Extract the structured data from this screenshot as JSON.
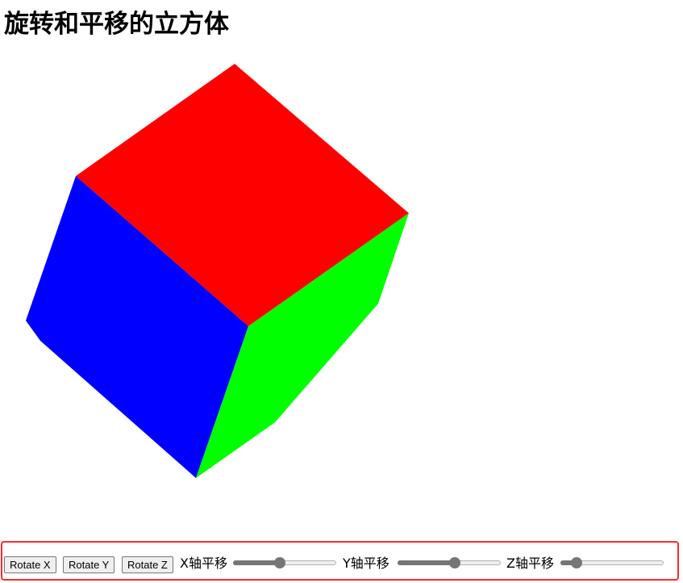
{
  "page": {
    "title": "旋转和平移的立方体"
  },
  "cube": {
    "faces": [
      {
        "name": "top",
        "color": "#ff0000"
      },
      {
        "name": "left",
        "color": "#0000ff"
      },
      {
        "name": "right",
        "color": "#00ff00"
      }
    ]
  },
  "controls": {
    "buttons": {
      "rotate_x": "Rotate X",
      "rotate_y": "Rotate Y",
      "rotate_z": "Rotate Z"
    },
    "sliders": [
      {
        "label": "X轴平移",
        "value_fraction": 0.45
      },
      {
        "label": "Y轴平移",
        "value_fraction": 0.56
      },
      {
        "label": "Z轴平移",
        "value_fraction": 0.11
      }
    ],
    "border_color": "#ff2a2a"
  }
}
